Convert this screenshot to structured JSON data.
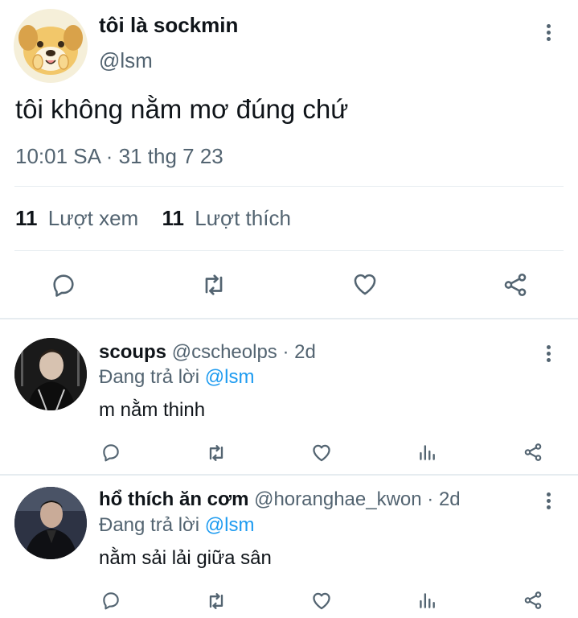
{
  "main_tweet": {
    "display_name": "tôi là sockmin",
    "handle": "@lsm",
    "text": "tôi không nằm mơ đúng chứ",
    "timestamp": "10:01 SA · 31 thg 7 23",
    "stats": {
      "views_count": "11",
      "views_label": "Lượt xem",
      "likes_count": "11",
      "likes_label": "Lượt thích"
    }
  },
  "replies": [
    {
      "display_name": "scoups",
      "handle": "@cscheolps",
      "time": "· 2d",
      "replying_prefix": "Đang trả lời",
      "replying_to": "@lsm",
      "text": "m nằm thinh"
    },
    {
      "display_name": "hổ thích ăn cơm",
      "handle": "@horanghae_kwon",
      "time": "· 2d",
      "replying_prefix": "Đang trả lời",
      "replying_to": "@lsm",
      "text": "nằm sải lải giữa sân"
    }
  ],
  "icons": [
    "more-vertical-icon",
    "reply-icon",
    "retweet-icon",
    "like-icon",
    "share-icon",
    "analytics-icon"
  ],
  "colors": {
    "link": "#1d9bf0",
    "muted": "#536471",
    "text": "#0f1419",
    "divider": "#e6ecf0"
  }
}
